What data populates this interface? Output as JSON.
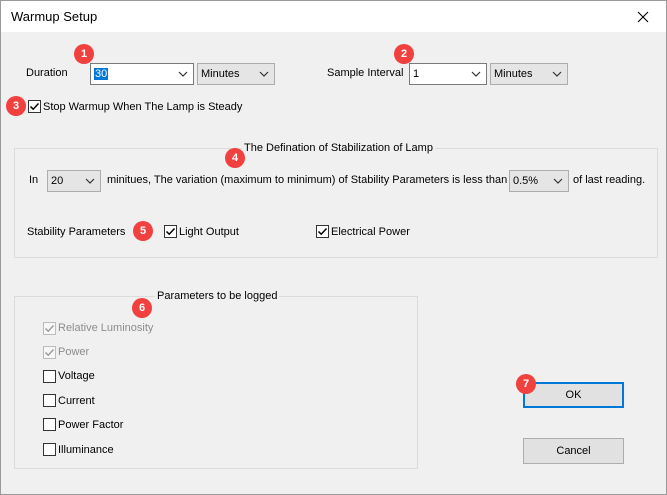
{
  "window": {
    "title": "Warmup Setup"
  },
  "colors": {
    "accent": "#0078d7",
    "marker": "#f0413f",
    "disabled": "#8d8d8d"
  },
  "duration": {
    "label": "Duration",
    "value": "30",
    "unit": "Minutes"
  },
  "sample_interval": {
    "label": "Sample Interval",
    "value": "1",
    "unit": "Minutes"
  },
  "stop_warmup": {
    "label": "Stop Warmup When The Lamp is Steady",
    "checked": true
  },
  "stabilization": {
    "title": "The Defination of Stabilization of Lamp",
    "in_label": "In",
    "minutes_value": "20",
    "sentence": "minitues, The variation (maximum to minimum) of Stability Parameters is less than",
    "percent_value": "0.5%",
    "suffix": "of last reading.",
    "params_label": "Stability Parameters",
    "light_output": {
      "label": "Light Output",
      "checked": true
    },
    "electrical_power": {
      "label": "Electrical Power",
      "checked": true
    }
  },
  "logged": {
    "title": "Parameters to be logged",
    "items": [
      {
        "label": "Relative Luminosity",
        "checked": true,
        "enabled": false
      },
      {
        "label": "Power",
        "checked": true,
        "enabled": false
      },
      {
        "label": "Voltage",
        "checked": false,
        "enabled": true
      },
      {
        "label": "Current",
        "checked": false,
        "enabled": true
      },
      {
        "label": "Power Factor",
        "checked": false,
        "enabled": true
      },
      {
        "label": "Illuminance",
        "checked": false,
        "enabled": true
      }
    ]
  },
  "buttons": {
    "ok": "OK",
    "cancel": "Cancel"
  },
  "markers": [
    "1",
    "2",
    "3",
    "4",
    "5",
    "6",
    "7"
  ]
}
